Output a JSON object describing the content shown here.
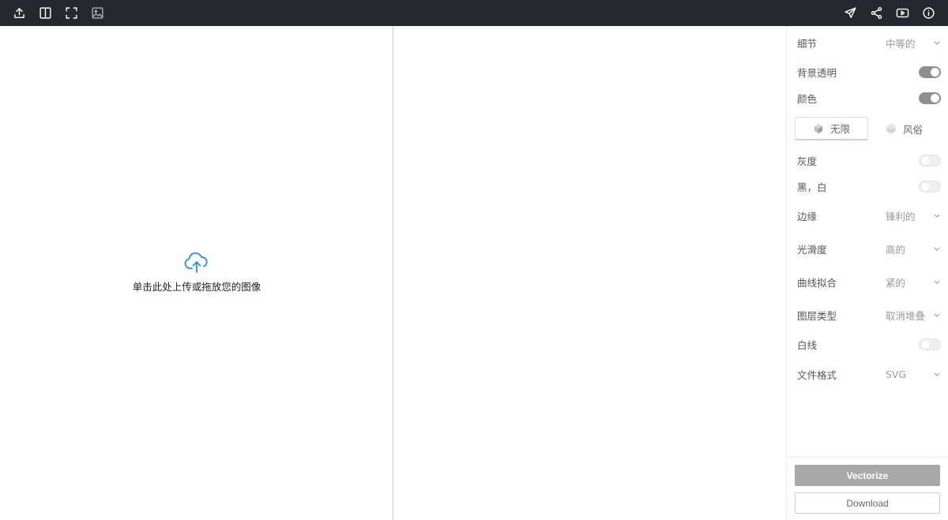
{
  "toolbar": {
    "left_icons": [
      "upload-icon",
      "split-view-icon",
      "fullscreen-icon",
      "image-icon"
    ],
    "right_icons": [
      "send-icon",
      "share-icon",
      "video-icon",
      "info-icon"
    ],
    "icon_color": "#ffffff",
    "background": "#25282e"
  },
  "upload": {
    "prompt": "单击此处上传或拖放您的图像",
    "icon": "cloud-upload-icon",
    "icon_color": "#2a8fd8"
  },
  "settings": {
    "detail": {
      "label": "细节",
      "value": "中等的"
    },
    "transparent_bg": {
      "label": "背景透明",
      "on": true
    },
    "color": {
      "label": "颜色",
      "on": true
    },
    "color_mode": {
      "options": [
        "无限",
        "风俗"
      ],
      "selected": "无限"
    },
    "grayscale": {
      "label": "灰度",
      "on": false
    },
    "black_white": {
      "label": "黑，白",
      "on": false
    },
    "edges": {
      "label": "边缘",
      "value": "锋利的"
    },
    "smoothness": {
      "label": "光滑度",
      "value": "高的"
    },
    "curve_fit": {
      "label": "曲线拟合",
      "value": "紧的"
    },
    "layer_type": {
      "label": "图层类型",
      "value": "取消堆叠"
    },
    "white_lines": {
      "label": "白线",
      "on": false
    },
    "file_format": {
      "label": "文件格式",
      "value": "SVG"
    }
  },
  "actions": {
    "vectorize": "Vectorize",
    "download": "Download"
  }
}
